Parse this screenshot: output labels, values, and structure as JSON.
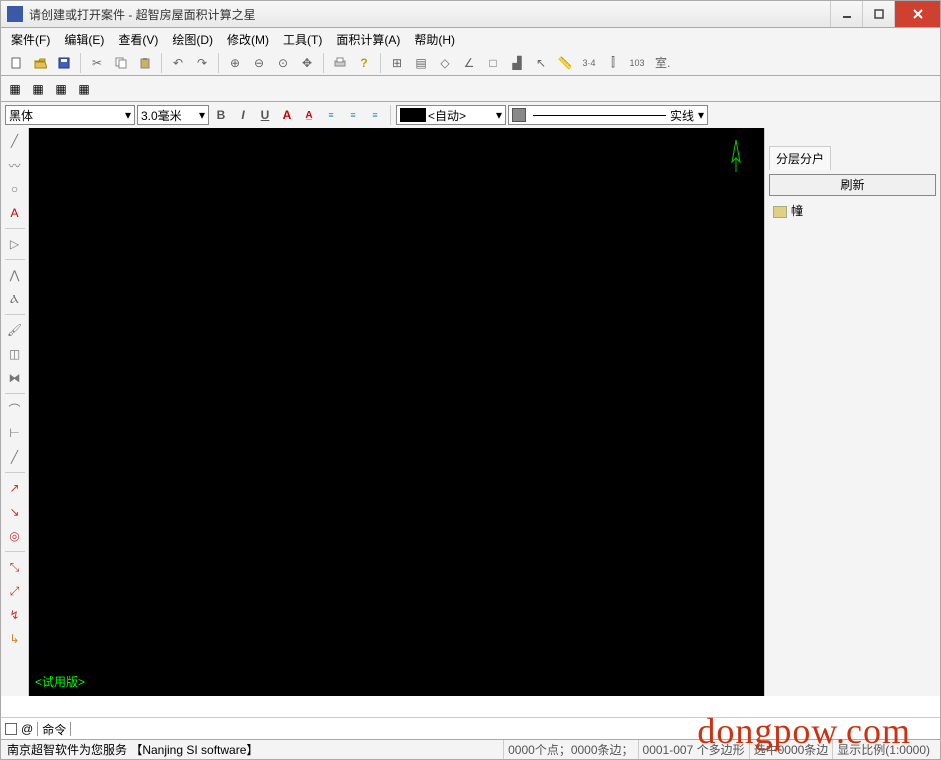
{
  "window": {
    "title": "请创建或打开案件 - 超智房屋面积计算之星"
  },
  "menu": {
    "items": [
      "案件(F)",
      "编辑(E)",
      "查看(V)",
      "绘图(D)",
      "修改(M)",
      "工具(T)",
      "面积计算(A)",
      "帮助(H)"
    ]
  },
  "toolbar3": {
    "room_label": "室."
  },
  "format": {
    "font": "黑体",
    "size": "3.0毫米",
    "auto_label": "<自动>",
    "line_style": "实线"
  },
  "canvas": {
    "trial": "<试用版>"
  },
  "right": {
    "tab": "分层分户",
    "refresh": "刷新",
    "tree_root": "幢"
  },
  "cmdline": {
    "at": "@",
    "prompt": "命令"
  },
  "status": {
    "left": "南京超智软件为您服务 【Nanjing SI software】",
    "points": "0000个点；0000条边；",
    "polys": "0001-007 个多边形",
    "sel": "选中0000条边",
    "scale": "显示比例(1:0000)"
  },
  "watermark": "dongpow.com"
}
